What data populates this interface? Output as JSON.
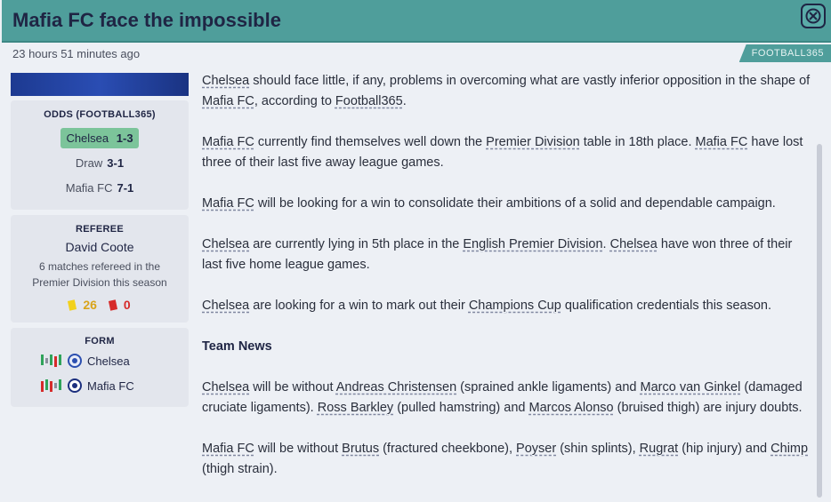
{
  "header": {
    "title": "Mafia FC face the impossible",
    "timestamp": "23 hours 51 minutes ago",
    "source": "FOOTBALL365"
  },
  "odds": {
    "heading": "ODDS (FOOTBALL365)",
    "rows": [
      {
        "label": "Chelsea",
        "value": "1-3"
      },
      {
        "label": "Draw",
        "value": "3-1"
      },
      {
        "label": "Mafia FC",
        "value": "7-1"
      }
    ]
  },
  "referee": {
    "heading": "REFEREE",
    "name": "David Coote",
    "info": "6 matches refereed in the Premier Division this season",
    "yellow": "26",
    "red": "0"
  },
  "form": {
    "heading": "FORM",
    "teams": [
      {
        "name": "Chelsea",
        "results": [
          "W",
          "D",
          "W",
          "L",
          "W"
        ]
      },
      {
        "name": "Mafia FC",
        "results": [
          "L",
          "W",
          "L",
          "D",
          "W"
        ]
      }
    ]
  },
  "article": {
    "p1": [
      {
        "t": "Chelsea",
        "link": true
      },
      {
        "t": " should face little, if any, problems in overcoming what are vastly inferior opposition in the shape of ",
        "link": false
      },
      {
        "t": "Mafia FC",
        "link": true
      },
      {
        "t": ", according to ",
        "link": false
      },
      {
        "t": "Football365",
        "link": true
      },
      {
        "t": ".",
        "link": false
      }
    ],
    "p2": [
      {
        "t": "Mafia FC",
        "link": true
      },
      {
        "t": " currently find themselves well down the ",
        "link": false
      },
      {
        "t": "Premier Division",
        "link": true
      },
      {
        "t": " table in 18th place. ",
        "link": false
      },
      {
        "t": "Mafia FC",
        "link": true
      },
      {
        "t": " have lost three of their last five away league games.",
        "link": false
      }
    ],
    "p3": [
      {
        "t": "Mafia FC",
        "link": true
      },
      {
        "t": " will be looking for a win to consolidate their ambitions of a solid and dependable campaign.",
        "link": false
      }
    ],
    "p4": [
      {
        "t": "Chelsea",
        "link": true
      },
      {
        "t": " are currently lying in 5th place in the ",
        "link": false
      },
      {
        "t": "English Premier Division",
        "link": true
      },
      {
        "t": ". ",
        "link": false
      },
      {
        "t": "Chelsea",
        "link": true
      },
      {
        "t": " have won three of their last five home league games.",
        "link": false
      }
    ],
    "p5": [
      {
        "t": "Chelsea",
        "link": true
      },
      {
        "t": " are looking for a win to mark out their ",
        "link": false
      },
      {
        "t": "Champions Cup",
        "link": true
      },
      {
        "t": " qualification credentials this season.",
        "link": false
      }
    ],
    "team_news_heading": "Team News",
    "p6": [
      {
        "t": "Chelsea",
        "link": true
      },
      {
        "t": " will be without ",
        "link": false
      },
      {
        "t": "Andreas Christensen",
        "link": true
      },
      {
        "t": " (sprained ankle ligaments) and ",
        "link": false
      },
      {
        "t": "Marco van Ginkel",
        "link": true
      },
      {
        "t": " (damaged cruciate ligaments). ",
        "link": false
      },
      {
        "t": "Ross Barkley",
        "link": true
      },
      {
        "t": " (pulled hamstring) and ",
        "link": false
      },
      {
        "t": "Marcos Alonso",
        "link": true
      },
      {
        "t": " (bruised thigh) are injury doubts.",
        "link": false
      }
    ],
    "p7": [
      {
        "t": "Mafia FC",
        "link": true
      },
      {
        "t": " will be without ",
        "link": false
      },
      {
        "t": "Brutus",
        "link": true
      },
      {
        "t": " (fractured cheekbone), ",
        "link": false
      },
      {
        "t": "Poyser",
        "link": true
      },
      {
        "t": " (shin splints), ",
        "link": false
      },
      {
        "t": "Rugrat",
        "link": true
      },
      {
        "t": " (hip injury) and ",
        "link": false
      },
      {
        "t": "Chimp",
        "link": true
      },
      {
        "t": " (thigh strain).",
        "link": false
      }
    ]
  },
  "icons": {
    "close": "close-icon",
    "yellow_card": "yellow-card-icon",
    "red_card": "red-card-icon"
  },
  "colors": {
    "header_teal": "#4f9e9b",
    "odds_highlight": "#7cc49a",
    "win": "#2fa35a",
    "loss": "#d62a2a",
    "draw": "#8a8f9c"
  }
}
